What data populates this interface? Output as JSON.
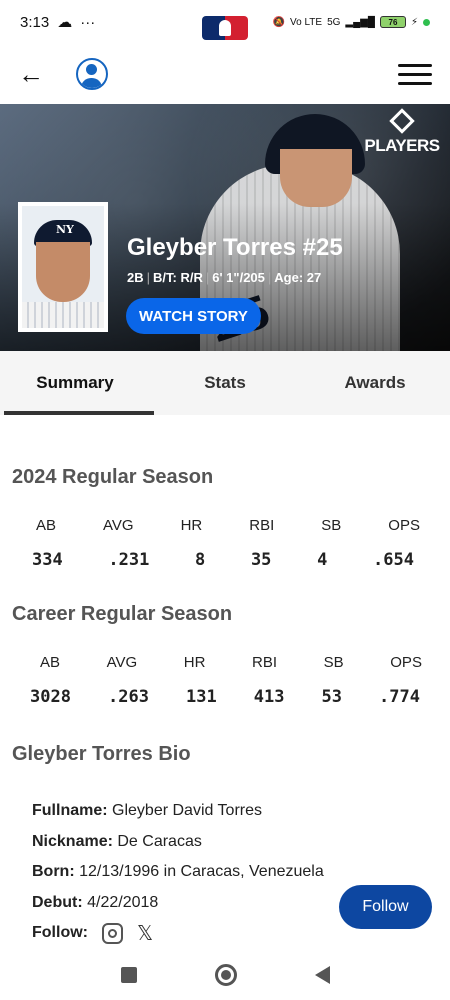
{
  "status_bar": {
    "time": "3:13",
    "dots": "···",
    "network": "5G",
    "volte": "Vo LTE",
    "battery": "76"
  },
  "header": {
    "back_icon": "arrow-left-icon",
    "avatar_icon": "user-circle-icon",
    "logo": "mlb-logo",
    "menu_icon": "hamburger-menu-icon"
  },
  "hero": {
    "badge_text": "PLAYERS",
    "player_name": "Gleyber Torres #25",
    "meta": [
      "2B",
      "B/T: R/R",
      "6' 1\"/205",
      "Age: 27"
    ],
    "jersey_number": "25",
    "watch_label": "WATCH STORY"
  },
  "tabs": [
    {
      "label": "Summary",
      "active": true
    },
    {
      "label": "Stats",
      "active": false
    },
    {
      "label": "Awards",
      "active": false
    }
  ],
  "season": {
    "title": "2024 Regular Season",
    "headers": [
      "AB",
      "AVG",
      "HR",
      "RBI",
      "SB",
      "OPS"
    ],
    "values": [
      "334",
      ".231",
      "8",
      "35",
      "4",
      ".654"
    ]
  },
  "career": {
    "title": "Career Regular Season",
    "headers": [
      "AB",
      "AVG",
      "HR",
      "RBI",
      "SB",
      "OPS"
    ],
    "values": [
      "3028",
      ".263",
      "131",
      "413",
      "53",
      ".774"
    ]
  },
  "bio": {
    "title": "Gleyber Torres Bio",
    "fullname_label": "Fullname:",
    "fullname": "Gleyber David Torres",
    "nickname_label": "Nickname:",
    "nickname": "De Caracas",
    "born_label": "Born:",
    "born": "12/13/1996 in Caracas, Venezuela",
    "debut_label": "Debut:",
    "debut": "4/22/2018",
    "follow_label": "Follow:",
    "x_glyph": "𝕏"
  },
  "follow_button": "Follow",
  "colors": {
    "accent": "#0a66e8",
    "follow": "#0d47a1",
    "mlb_blue": "#0d2b6b",
    "mlb_red": "#d32030"
  }
}
